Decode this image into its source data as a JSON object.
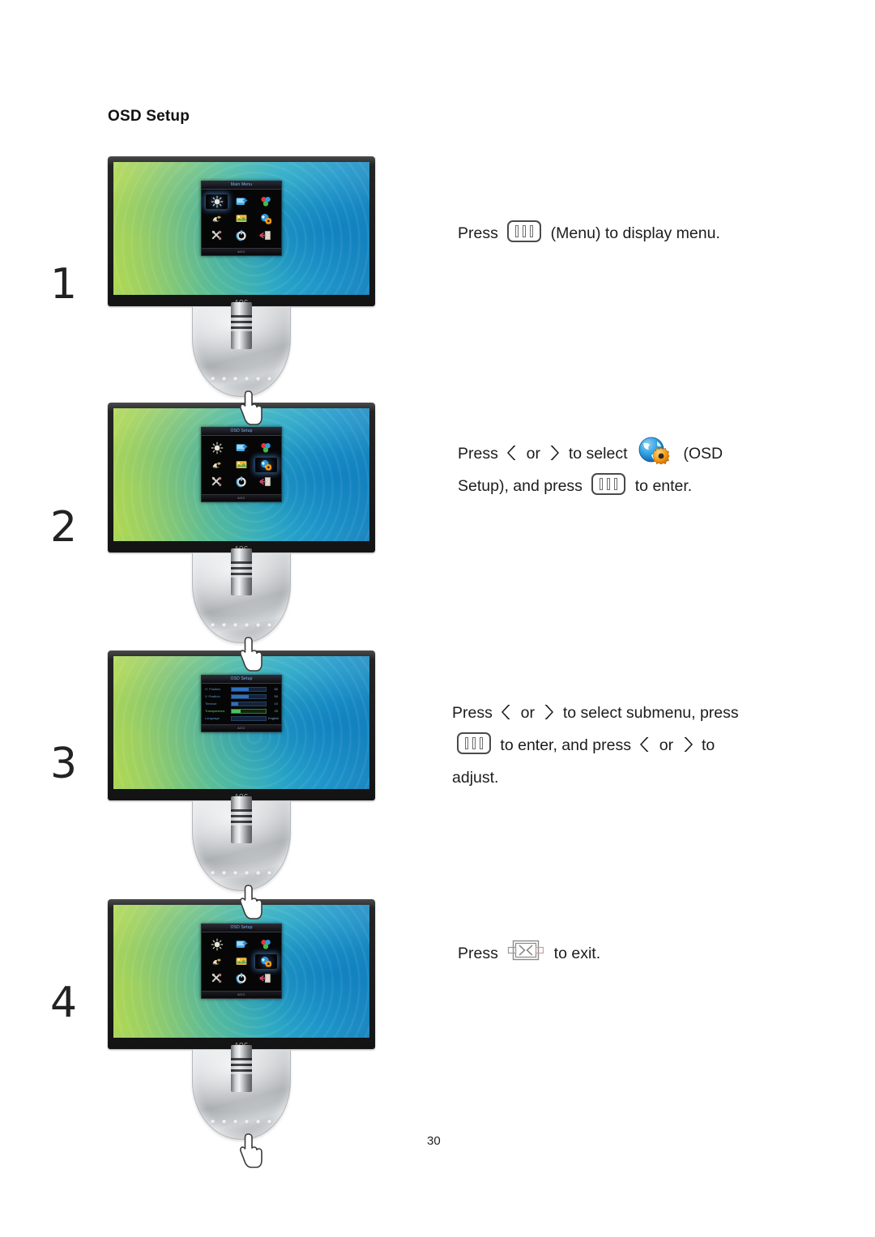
{
  "document": {
    "section_title": "OSD Setup",
    "page_number": "30"
  },
  "icons": {
    "menu_key": "menu-key-icon",
    "left_chevron": "chevron-left-icon",
    "right_chevron": "chevron-right-icon",
    "exit_key": "exit-key-icon",
    "globe_gear": "osd-setup-globe-gear-icon",
    "hand": "pointing-hand-icon"
  },
  "steps": [
    {
      "number": "1",
      "monitor": {
        "brand": "AOC",
        "osd": {
          "mode": "grid",
          "title": "Main Menu",
          "footer": "AOC",
          "selected_index": 0,
          "items": [
            {
              "name": "luminance-icon",
              "label": "Luminance"
            },
            {
              "name": "image-setup-icon",
              "label": "Image Setup"
            },
            {
              "name": "color-setup-icon",
              "label": "Color Setup"
            },
            {
              "name": "picture-boost-icon",
              "label": "Picture Boost"
            },
            {
              "name": "picture-in-picture-icon",
              "label": "PIP Setting"
            },
            {
              "name": "osd-setup-icon",
              "label": "OSD Setup"
            },
            {
              "name": "extra-icon",
              "label": "Extra"
            },
            {
              "name": "reset-icon",
              "label": "Reset"
            },
            {
              "name": "exit-icon",
              "label": "Exit"
            }
          ]
        }
      },
      "text": {
        "lines": [
          [
            {
              "t": "text",
              "v": "Press "
            },
            {
              "t": "icon",
              "v": "menu-key-icon"
            },
            {
              "t": "text",
              "v": " (Menu) to display menu."
            }
          ]
        ]
      }
    },
    {
      "number": "2",
      "monitor": {
        "brand": "AOC",
        "osd": {
          "mode": "grid",
          "title": "OSD Setup",
          "footer": "AOC",
          "selected_index": 5,
          "items": [
            {
              "name": "luminance-icon",
              "label": "Luminance"
            },
            {
              "name": "image-setup-icon",
              "label": "Image Setup"
            },
            {
              "name": "color-setup-icon",
              "label": "Color Setup"
            },
            {
              "name": "picture-boost-icon",
              "label": "Picture Boost"
            },
            {
              "name": "picture-in-picture-icon",
              "label": "PIP Setting"
            },
            {
              "name": "osd-setup-icon",
              "label": "OSD Setup"
            },
            {
              "name": "extra-icon",
              "label": "Extra"
            },
            {
              "name": "reset-icon",
              "label": "Reset"
            },
            {
              "name": "exit-icon",
              "label": "Exit"
            }
          ]
        }
      },
      "text": {
        "lines": [
          [
            {
              "t": "text",
              "v": "Press "
            },
            {
              "t": "icon",
              "v": "chevron-left-icon"
            },
            {
              "t": "text",
              "v": " or "
            },
            {
              "t": "icon",
              "v": "chevron-right-icon"
            },
            {
              "t": "text",
              "v": " to select "
            },
            {
              "t": "icon",
              "v": "osd-setup-globe-gear-icon"
            },
            {
              "t": "text",
              "v": " (OSD"
            }
          ],
          [
            {
              "t": "text",
              "v": "Setup), and press "
            },
            {
              "t": "icon",
              "v": "menu-key-icon"
            },
            {
              "t": "text",
              "v": " to enter."
            }
          ]
        ]
      }
    },
    {
      "number": "3",
      "monitor": {
        "brand": "AOC",
        "osd": {
          "mode": "list",
          "title": "OSD Setup",
          "footer": "AOC",
          "active_index": 3,
          "rows": [
            {
              "label": "H. Position",
              "value": "50",
              "fill": 50
            },
            {
              "label": "V. Position",
              "value": "50",
              "fill": 50
            },
            {
              "label": "Timeout",
              "value": "10",
              "fill": 20
            },
            {
              "label": "Transparence",
              "value": "25",
              "fill": 25
            },
            {
              "label": "Language",
              "value": "English",
              "fill": 0
            }
          ]
        }
      },
      "text": {
        "lines": [
          [
            {
              "t": "text",
              "v": "Press "
            },
            {
              "t": "icon",
              "v": "chevron-left-icon"
            },
            {
              "t": "text",
              "v": " or "
            },
            {
              "t": "icon",
              "v": "chevron-right-icon"
            },
            {
              "t": "text",
              "v": " to select submenu, press"
            }
          ],
          [
            {
              "t": "icon",
              "v": "menu-key-icon"
            },
            {
              "t": "text",
              "v": " to enter, and press "
            },
            {
              "t": "icon",
              "v": "chevron-left-icon"
            },
            {
              "t": "text",
              "v": " or "
            },
            {
              "t": "icon",
              "v": "chevron-right-icon"
            },
            {
              "t": "text",
              "v": " to"
            }
          ],
          [
            {
              "t": "text",
              "v": "adjust."
            }
          ]
        ]
      }
    },
    {
      "number": "4",
      "monitor": {
        "brand": "AOC",
        "osd": {
          "mode": "grid",
          "title": "OSD Setup",
          "footer": "AOC",
          "selected_index": 5,
          "items": [
            {
              "name": "luminance-icon",
              "label": "Luminance"
            },
            {
              "name": "image-setup-icon",
              "label": "Image Setup"
            },
            {
              "name": "color-setup-icon",
              "label": "Color Setup"
            },
            {
              "name": "picture-boost-icon",
              "label": "Picture Boost"
            },
            {
              "name": "picture-in-picture-icon",
              "label": "PIP Setting"
            },
            {
              "name": "osd-setup-icon",
              "label": "OSD Setup"
            },
            {
              "name": "extra-icon",
              "label": "Extra"
            },
            {
              "name": "reset-icon",
              "label": "Reset"
            },
            {
              "name": "exit-icon",
              "label": "Exit"
            }
          ]
        }
      },
      "text": {
        "lines": [
          [
            {
              "t": "text",
              "v": "Press "
            },
            {
              "t": "icon",
              "v": "exit-key-icon"
            },
            {
              "t": "text",
              "v": " to exit."
            }
          ]
        ]
      }
    }
  ]
}
